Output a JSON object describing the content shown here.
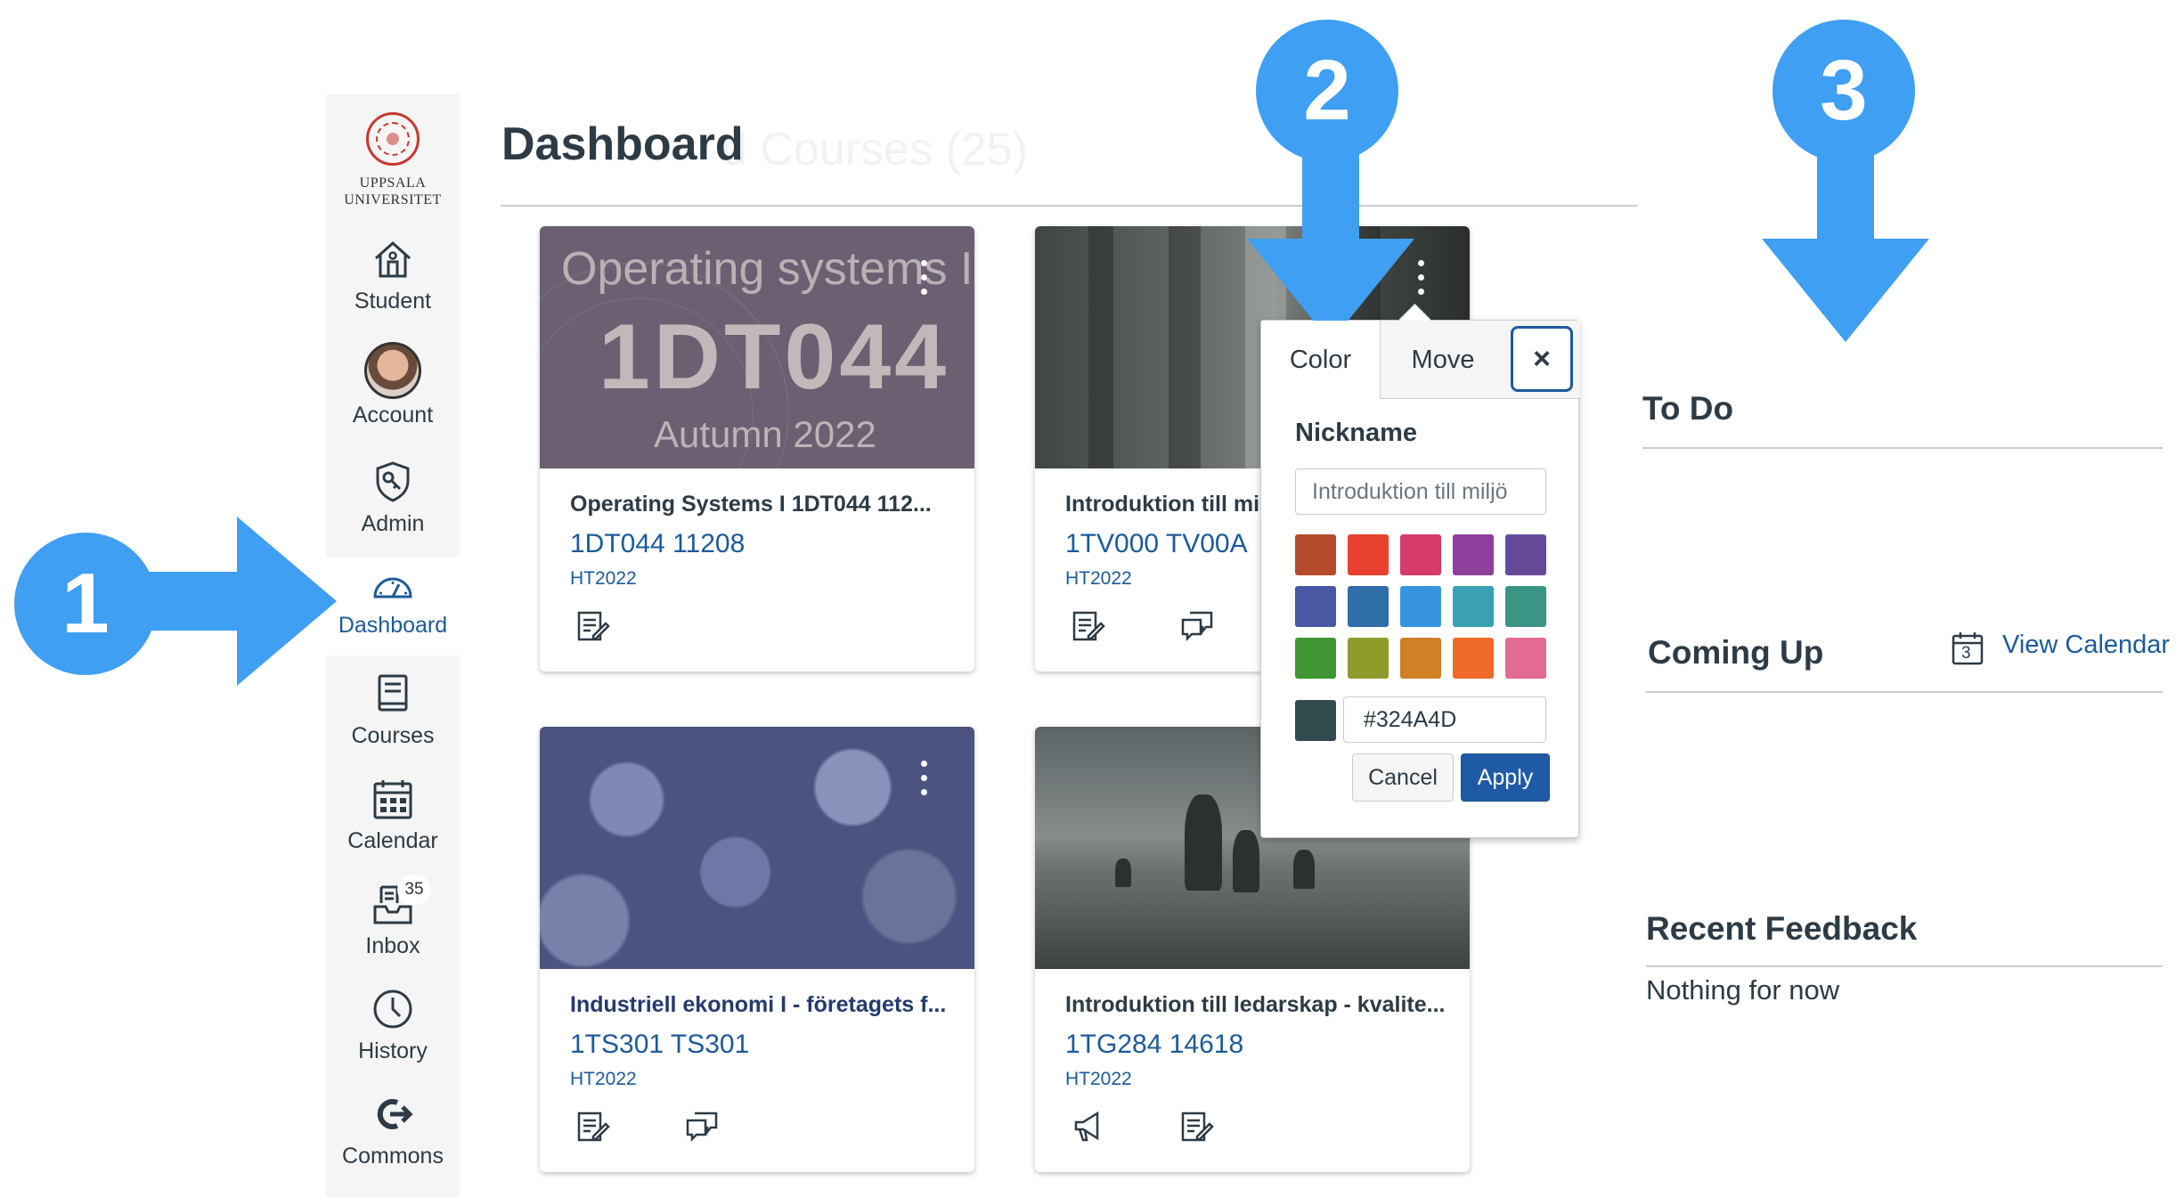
{
  "sidebar": {
    "logo": {
      "name_line1": "UPPSALA",
      "name_line2": "UNIVERSITET"
    },
    "items": [
      {
        "label": "Student",
        "icon": "home-icon"
      },
      {
        "label": "Account",
        "icon": "avatar"
      },
      {
        "label": "Admin",
        "icon": "shield-key-icon"
      },
      {
        "label": "Dashboard",
        "icon": "speedometer-icon",
        "active": true
      },
      {
        "label": "Courses",
        "icon": "book-icon"
      },
      {
        "label": "Calendar",
        "icon": "calendar-icon"
      },
      {
        "label": "Inbox",
        "icon": "inbox-icon",
        "badge": "35"
      },
      {
        "label": "History",
        "icon": "clock-icon"
      },
      {
        "label": "Commons",
        "icon": "commons-icon"
      }
    ]
  },
  "header": {
    "title": "Dashboard",
    "ghost_title": "d Courses (25)"
  },
  "cards": [
    {
      "title": "Operating Systems I 1DT044 112...",
      "code": "1DT044 11208",
      "term": "HT2022",
      "hero": {
        "line1": "Operating systems I",
        "line2": "1DT044",
        "line3": "Autumn 2022"
      }
    },
    {
      "title": "Introduktion till mi",
      "code": "1TV000 TV00A",
      "term": "HT2022"
    },
    {
      "title": "Industriell ekonomi I - företagets f...",
      "code": "1TS301 TS301",
      "term": "HT2022"
    },
    {
      "title": "Introduktion till ledarskap - kvalite...",
      "code": "1TG284 14618",
      "term": "HT2022"
    }
  ],
  "popover": {
    "tabs": {
      "color": "Color",
      "move": "Move",
      "close": "×"
    },
    "nickname_label": "Nickname",
    "nickname_value": "Introduktion till miljö",
    "swatches": [
      "#b54b2b",
      "#e8412f",
      "#d63a6a",
      "#8e3f9c",
      "#654a9a",
      "#4a57a2",
      "#2f6ea7",
      "#3795df",
      "#3aa0b3",
      "#3a9585",
      "#3f9632",
      "#8f9c2b",
      "#cf8126",
      "#f06a2a",
      "#e36b91"
    ],
    "hex_value": "#324A4D",
    "hex_color": "#324A4D",
    "cancel_label": "Cancel",
    "apply_label": "Apply"
  },
  "right_column": {
    "todo_title": "To Do",
    "coming_up_title": "Coming Up",
    "view_calendar_label": "View Calendar",
    "calendar_day": "3",
    "recent_feedback_title": "Recent Feedback",
    "recent_feedback_empty": "Nothing for now"
  },
  "annotations": {
    "marker1": "1",
    "marker2": "2",
    "marker3": "3",
    "color": "#3f9ff2"
  }
}
